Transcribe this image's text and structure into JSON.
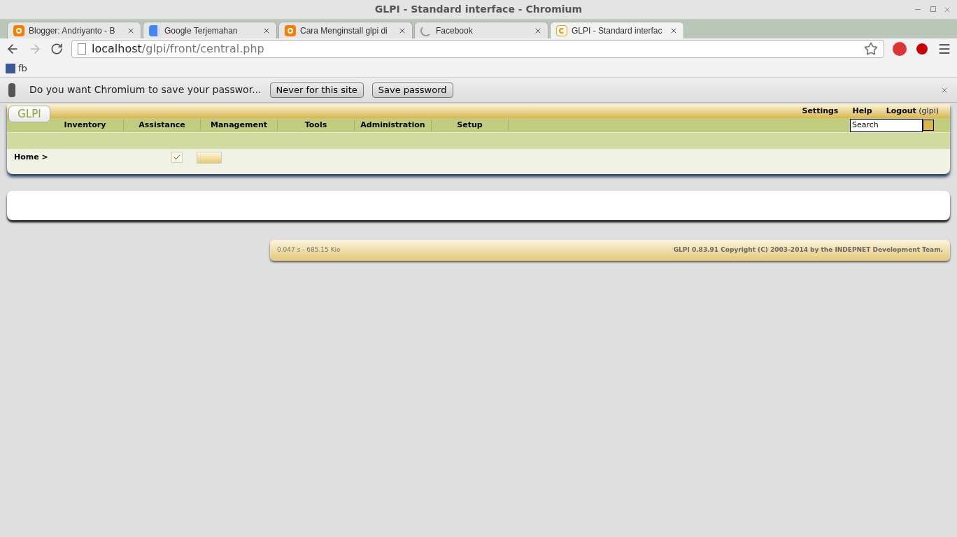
{
  "window": {
    "title": "GLPI - Standard interface - Chromium"
  },
  "tabs": [
    {
      "label": "Blogger: Andriyanto - B",
      "kind": "blogger",
      "selected": false
    },
    {
      "label": "Google Terjemahan",
      "kind": "translate",
      "selected": false
    },
    {
      "label": "Cara Menginstall glpi di",
      "kind": "blogger",
      "selected": false
    },
    {
      "label": "Facebook",
      "kind": "loading",
      "selected": false
    },
    {
      "label": "GLPI - Standard interfac",
      "kind": "glpi",
      "selected": true
    }
  ],
  "address": {
    "host": "localhost",
    "path": "/glpi/front/central.php"
  },
  "bookmarks": [
    {
      "label": "fb"
    }
  ],
  "infobar": {
    "message": "Do you want Chromium to save your passwor...",
    "buttons": [
      "Never for this site",
      "Save password"
    ]
  },
  "glpi": {
    "logo": "GLPI",
    "top_links": [
      {
        "label": "Settings"
      },
      {
        "label": "Help"
      },
      {
        "label": "Logout",
        "note": "(glpi)"
      }
    ],
    "menu": [
      "Inventory",
      "Assistance",
      "Management",
      "Tools",
      "Administration",
      "Setup"
    ],
    "search": {
      "placeholder": "Search"
    },
    "breadcrumb": "Home >",
    "footer": {
      "timing": "0.047 s - 685.15 Kio",
      "copyright": "GLPI 0.83.91 Copyright (C) 2003-2014 by the INDEPNET Development Team."
    }
  }
}
